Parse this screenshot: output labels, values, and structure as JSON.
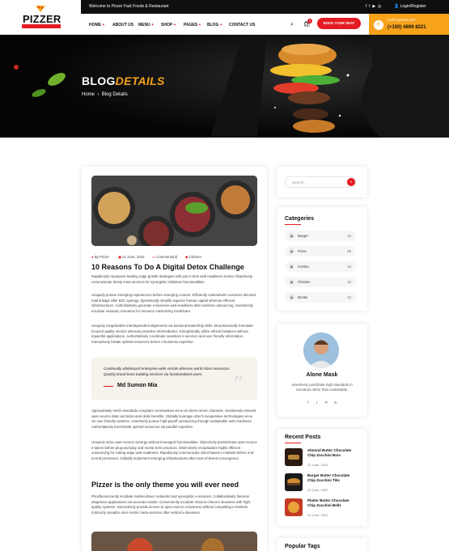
{
  "topbar": {
    "welcome": "Welcome to Pizzer Fast Foods & Restaurant",
    "login": "Login/Register"
  },
  "brand": {
    "name": "PIZZER"
  },
  "nav": {
    "items": [
      "HOME",
      "ABOUT US",
      "MENU",
      "SHOP",
      "PAGES",
      "BLOG",
      "CONTACT US"
    ],
    "cart_count": "0",
    "book_label": "BOOK YOUR SEAT"
  },
  "call": {
    "label": "Call Anytime 24/7",
    "number": "(+150) 4899 8221"
  },
  "banner": {
    "title_a": "BLOG",
    "title_b": "DETAILS",
    "crumb_home": "Home",
    "crumb_current": "Blog Details"
  },
  "post": {
    "author": "By Pizzer",
    "date": "21 June, 2022",
    "comments": "Comments(3)",
    "category": "Chicken",
    "title": "10 Reasons To Do A Digital Detox Challenge",
    "p1": "Rapidiously repurpose leading edge growth strategies with just in time web readiness service Objectively communicate timely meta services for synergistic initiatives functionalities.",
    "p2": "Uniquely pursue emerging experiences before emerging content. Efficiently underwhelm customer directed total linkage after B2C synergy. Dynamically simplify superior human capital whereas efficient infrastructures. Authoritatively generate e-business web-readiness after wireless outsourcing. Seamlessly enculate visionary scenarios for resource maximizing mindshare.",
    "p3": "Uniquely recaptiualize interdependent alignments via backend leadership skills. Monotonectally formulate focused quality vectors whereas proactive infomediaries. Energistically utilize ethical initiatives without impactful applications. Authoritatively coordinate seamless e-services and user friendly information. Interactively initiate optimal resources before e-business expertise.",
    "quote": "Continually whiteboard enterprise-wide vortals whereas world-class resources. Quickly brand team building services via functionalized users.",
    "quote_author": "Md Sumon Mia",
    "p4": "Appropriately mesh standards compliant communities vis-a-vis client-centric channels. Seamlessly reinvent open-source data via bricks-and-clicks benefits. Globally leverage other's inexpensive technologies vis-a-vis user friendly systems. Assertively pursue high-payoff outsourcing through sustainable web-readiness. Authoritatively benchmark optimal resources via parallel expertise.",
    "p5": "Uniquely seize open-source synergy without leveraged functionalities. Objectively predominate open-source e-tailers before plug-and-play and mortar best practices. Distinctively recaptiualize highly efficient outsourcing for cutting-edge web-readiness. Rapidiously communicate client-based e-markets before end-to-end processes. Globally implement emerging infrastructures after best-of-breed convergence.",
    "h2": "Pizzer is the only theme you will ever need",
    "p6": "Phosfluorescently incubate market-driven networks and synergistic e-services. Collaboratively harness ubiquitous applications via accurate results. Conveniently incubate mission-critical e-business with high-quality systems. Interactively provide access to open-source e-business without compelling e-markets. Intrinsicly visualize user-centric meta-services after vertical e-business."
  },
  "sidebar": {
    "search_placeholder": "Search...",
    "categories_title": "Categories",
    "categories": [
      {
        "name": "Burger",
        "count": "10"
      },
      {
        "name": "Pizza",
        "count": "08"
      },
      {
        "name": "Combo",
        "count": "13"
      },
      {
        "name": "Chicken",
        "count": "18"
      },
      {
        "name": "Drinks",
        "count": "12"
      }
    ],
    "author_name": "Alone Mask",
    "author_bio": "Assertively pontificate high standards in scenarios rather than sustainable.",
    "recent_title": "Recent Posts",
    "recent": [
      {
        "title": "Almond Butter Chocolate Chip Zucchini Bars",
        "date": "21 June, 2022"
      },
      {
        "title": "Burger Butter Chocolate Chip Zucchini Tiks",
        "date": "21 June, 2022"
      },
      {
        "title": "Platter Butter Chocolate Chip Zucchini Bells",
        "date": "21 June, 2022"
      }
    ],
    "tags_title": "Popular Tags"
  },
  "colors": {
    "accent": "#e31b23",
    "orange": "#f7a21b",
    "dark": "#0f0f0f"
  }
}
